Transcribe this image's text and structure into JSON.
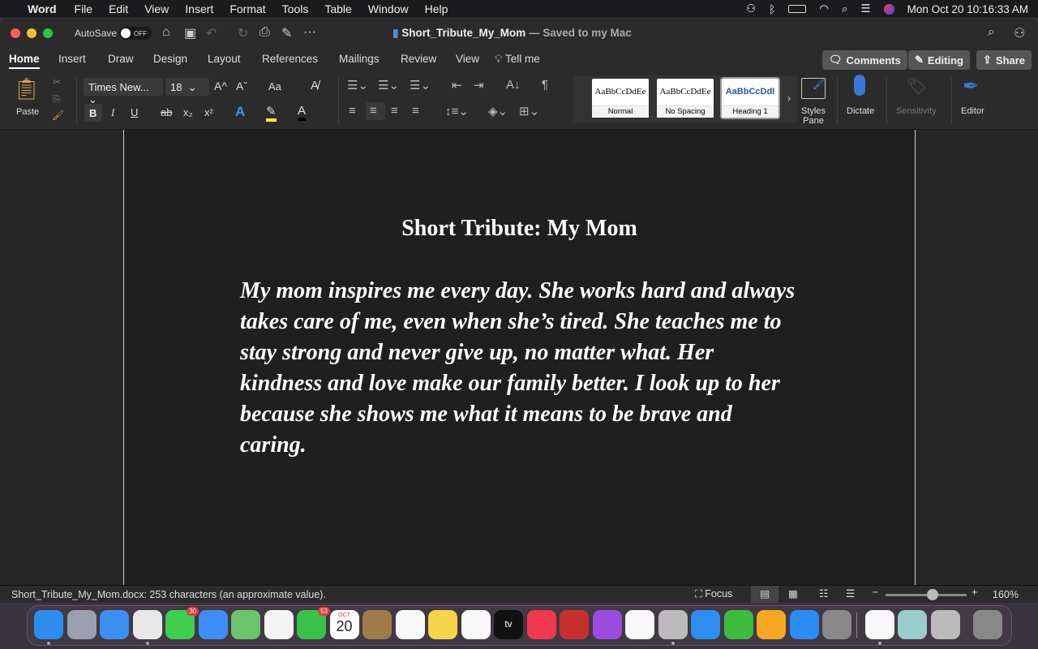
{
  "menubar": {
    "apple": "",
    "app": "Word",
    "items": [
      "File",
      "Edit",
      "View",
      "Insert",
      "Format",
      "Tools",
      "Table",
      "Window",
      "Help"
    ],
    "datetime": "Mon Oct 20  10:16:33 AM"
  },
  "titlebar": {
    "autosave": "AutoSave",
    "toggle": "OFF",
    "doc_name": "Short_Tribute_My_Mom",
    "saved": " — Saved to my Mac"
  },
  "tabs": [
    "Home",
    "Insert",
    "Draw",
    "Design",
    "Layout",
    "References",
    "Mailings",
    "Review",
    "View"
  ],
  "tell_me": "Tell me",
  "actions": {
    "comments": "Comments",
    "editing": "Editing",
    "share": "Share"
  },
  "ribbon": {
    "paste": "Paste",
    "font": "Times New...",
    "size": "18",
    "bold": "B",
    "italic": "I",
    "underline": "U",
    "strike": "ab",
    "sub": "x₂",
    "sup": "x²",
    "change_case": "Aa",
    "grow": "A^",
    "shrink": "Aˇ",
    "styles": [
      {
        "preview": "AaBbCcDdEe",
        "name": "Normal"
      },
      {
        "preview": "AaBbCcDdEe",
        "name": "No Spacing"
      },
      {
        "preview": "AaBbCcDdI",
        "name": "Heading 1"
      }
    ],
    "styles_pane": "Styles Pane",
    "dictate": "Dictate",
    "sensitivity": "Sensitivity",
    "editor": "Editor"
  },
  "document": {
    "heading": "Short Tribute: My Mom",
    "body": "My mom inspires me every day. She works hard and always takes care of me, even when she’s tired. She teaches me to stay strong and never give up, no matter what. Her kindness and love make our family better. I look up to her because she shows me what it means to be brave and caring."
  },
  "status": {
    "text": "Short_Tribute_My_Mom.docx: 253 characters (an approximate value).",
    "focus": "Focus",
    "zoom": "160%",
    "zoom_value": 160
  },
  "dock": [
    {
      "name": "finder",
      "c": "#2d8cf0"
    },
    {
      "name": "launchpad",
      "c": "#9aa0b0"
    },
    {
      "name": "safari",
      "c": "#3b8ff0"
    },
    {
      "name": "chrome",
      "c": "#e8e8e8"
    },
    {
      "name": "messages",
      "c": "#3ecf4f",
      "badge": "30"
    },
    {
      "name": "mail",
      "c": "#3c8df5"
    },
    {
      "name": "maps",
      "c": "#6bc46b"
    },
    {
      "name": "photos",
      "c": "#f4f4f4"
    },
    {
      "name": "facetime",
      "c": "#39c24a",
      "badge": "53"
    },
    {
      "name": "calendar",
      "c": "#ffffff",
      "month": "OCT",
      "day": "20"
    },
    {
      "name": "contacts",
      "c": "#a07b4a"
    },
    {
      "name": "reminders",
      "c": "#f8f8f8"
    },
    {
      "name": "notes",
      "c": "#f6d54a"
    },
    {
      "name": "freeform",
      "c": "#f8f8f8"
    },
    {
      "name": "apple-tv",
      "c": "#111",
      "label": "tv"
    },
    {
      "name": "music",
      "c": "#f0384e"
    },
    {
      "name": "photo-booth",
      "c": "#c8302e"
    },
    {
      "name": "podcasts",
      "c": "#9a4ce0"
    },
    {
      "name": "news",
      "c": "#f8f8f8"
    },
    {
      "name": "iphone-mirroring",
      "c": "#bbb"
    },
    {
      "name": "keynote",
      "c": "#2f8cf0"
    },
    {
      "name": "numbers",
      "c": "#3dbb3d"
    },
    {
      "name": "pages",
      "c": "#f5a623"
    },
    {
      "name": "app-store",
      "c": "#2a8cf5"
    },
    {
      "name": "system-settings",
      "c": "#888"
    },
    {
      "name": "word",
      "c": "#f8f8f8"
    },
    {
      "name": "preview",
      "c": "#9cc"
    },
    {
      "name": "calculator",
      "c": "#bbb"
    },
    {
      "name": "trash",
      "c": "#888"
    }
  ]
}
